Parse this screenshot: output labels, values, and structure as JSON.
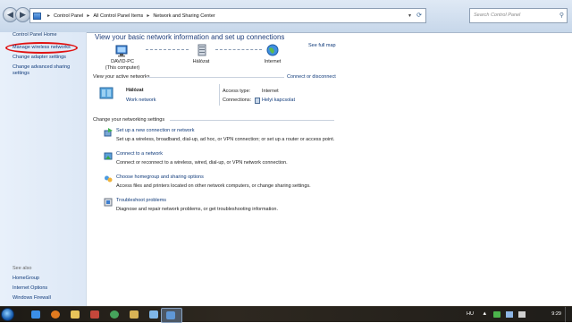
{
  "window": {
    "breadcrumb": [
      "Control Panel",
      "All Control Panel Items",
      "Network and Sharing Center"
    ],
    "search_placeholder": "Search Control Panel"
  },
  "sidebar": {
    "home": "Control Panel Home",
    "links": [
      "Manage wireless networks",
      "Change adapter settings",
      "Change advanced sharing settings"
    ],
    "see_also_title": "See also",
    "see_also": [
      "HomeGroup",
      "Internet Options",
      "Windows Firewall"
    ]
  },
  "main": {
    "title": "View your basic network information and set up connections",
    "see_full_map": "See full map",
    "map_nodes": [
      {
        "name": "DAVID-PC",
        "sub": "(This computer)"
      },
      {
        "name": "Hálózat",
        "sub": ""
      },
      {
        "name": "Internet",
        "sub": ""
      }
    ],
    "active_title": "View your active networks",
    "connect_disconnect": "Connect or disconnect",
    "network_name": "Hálózat",
    "network_type": "Work network",
    "access_type_label": "Access type:",
    "access_type_value": "Internet",
    "connections_label": "Connections:",
    "connections_value": "Helyi kapcsolat",
    "settings_title": "Change your networking settings",
    "tasks": [
      {
        "title": "Set up a new connection or network",
        "desc": "Set up a wireless, broadband, dial-up, ad hoc, or VPN connection; or set up a router or access point."
      },
      {
        "title": "Connect to a network",
        "desc": "Connect or reconnect to a wireless, wired, dial-up, or VPN network connection."
      },
      {
        "title": "Choose homegroup and sharing options",
        "desc": "Access files and printers located on other network computers, or change sharing settings."
      },
      {
        "title": "Troubleshoot problems",
        "desc": "Diagnose and repair network problems, or get troubleshooting information."
      }
    ]
  },
  "taskbar": {
    "lang": "HU",
    "time": "9:29"
  },
  "colors": {
    "link": "#0f3a7a",
    "highlight_ring": "#e01212",
    "sidebar_bg": "#e3edf9"
  }
}
